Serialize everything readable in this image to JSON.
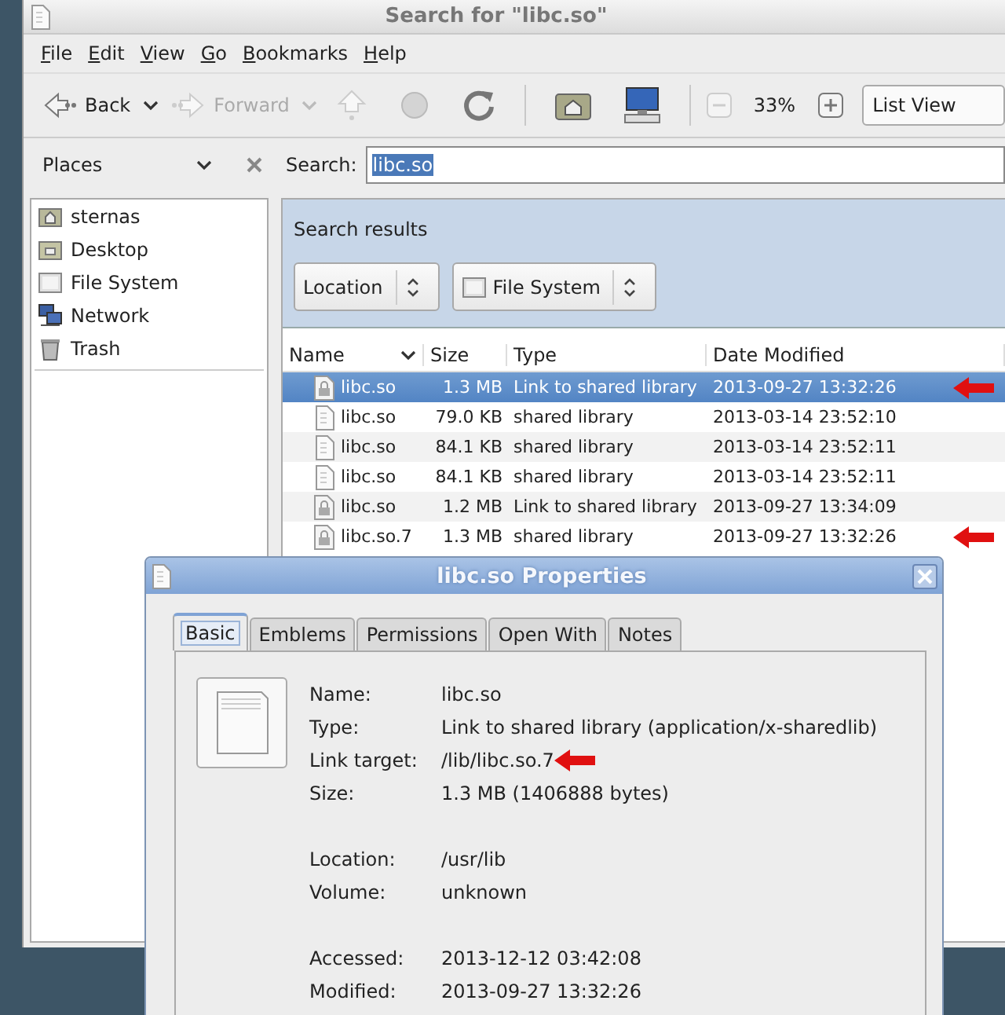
{
  "window": {
    "title": "Search for \"libc.so\""
  },
  "menu": [
    "File",
    "Edit",
    "View",
    "Go",
    "Bookmarks",
    "Help"
  ],
  "toolbar": [
    {
      "kind": "back",
      "label": "Back",
      "disabled": false
    },
    {
      "kind": "forward",
      "label": "Forward",
      "disabled": true
    },
    {
      "kind": "up",
      "disabled": true
    },
    {
      "kind": "stop",
      "disabled": true
    },
    {
      "kind": "reload",
      "disabled": false
    },
    {
      "kind": "separator"
    },
    {
      "kind": "home"
    },
    {
      "kind": "computer"
    },
    {
      "kind": "separator"
    },
    {
      "kind": "zoom-out",
      "disabled": true
    },
    {
      "kind": "zoom-level",
      "label": "33%"
    },
    {
      "kind": "zoom-in",
      "disabled": false
    },
    {
      "kind": "view",
      "label": "List View"
    }
  ],
  "sidebar": {
    "title": "Places",
    "items": [
      {
        "kind": "home",
        "label": "sternas"
      },
      {
        "kind": "desktop",
        "label": "Desktop"
      },
      {
        "kind": "drive",
        "label": "File System"
      },
      {
        "kind": "network",
        "label": "Network"
      },
      {
        "kind": "trash",
        "label": "Trash"
      }
    ]
  },
  "search": {
    "label": "Search:",
    "value": "libc.so",
    "selected": true
  },
  "results": {
    "title": "Search results",
    "filters": [
      {
        "label": "Location",
        "icon": false
      },
      {
        "label": "File System",
        "icon": true
      }
    ],
    "columns": [
      "Name",
      "Size",
      "Type",
      "Date Modified"
    ],
    "rows": [
      {
        "kind": "link",
        "name": "libc.so",
        "size": "1.3 MB",
        "type": "Link to shared library",
        "date": "2013-09-27 13:32:26",
        "selected": true,
        "marked": true
      },
      {
        "kind": "file",
        "name": "libc.so",
        "size": "79.0 KB",
        "type": "shared library",
        "date": "2013-03-14 23:52:10",
        "selected": false,
        "marked": false
      },
      {
        "kind": "file",
        "name": "libc.so",
        "size": "84.1 KB",
        "type": "shared library",
        "date": "2013-03-14 23:52:11",
        "selected": false,
        "marked": false
      },
      {
        "kind": "file",
        "name": "libc.so",
        "size": "84.1 KB",
        "type": "shared library",
        "date": "2013-03-14 23:52:11",
        "selected": false,
        "marked": false
      },
      {
        "kind": "link",
        "name": "libc.so",
        "size": "1.2 MB",
        "type": "Link to shared library",
        "date": "2013-09-27 13:34:09",
        "selected": false,
        "marked": false
      },
      {
        "kind": "link",
        "name": "libc.so.7",
        "size": "1.3 MB",
        "type": "shared library",
        "date": "2013-09-27 13:32:26",
        "selected": false,
        "marked": true
      }
    ]
  },
  "dialog": {
    "title": "libc.so Properties",
    "tabs": [
      {
        "label": "Basic",
        "selected": true
      },
      {
        "label": "Emblems",
        "selected": false
      },
      {
        "label": "Permissions",
        "selected": false
      },
      {
        "label": "Open With",
        "selected": false
      },
      {
        "label": "Notes",
        "selected": false
      }
    ],
    "groups": [
      [
        {
          "label": "Name:",
          "value": "libc.so",
          "marked": false
        },
        {
          "label": "Type:",
          "value": "Link to shared library (application/x-sharedlib)",
          "marked": false
        },
        {
          "label": "Link target:",
          "value": "/lib/libc.so.7",
          "marked": true
        },
        {
          "label": "Size:",
          "value": "1.3 MB (1406888 bytes)",
          "marked": false
        }
      ],
      [
        {
          "label": "Location:",
          "value": "/usr/lib",
          "marked": false
        },
        {
          "label": "Volume:",
          "value": "unknown",
          "marked": false
        }
      ],
      [
        {
          "label": "Accessed:",
          "value": "2013-12-12 03:42:08",
          "marked": false
        },
        {
          "label": "Modified:",
          "value": "2013-09-27 13:32:26",
          "marked": false
        }
      ]
    ]
  }
}
